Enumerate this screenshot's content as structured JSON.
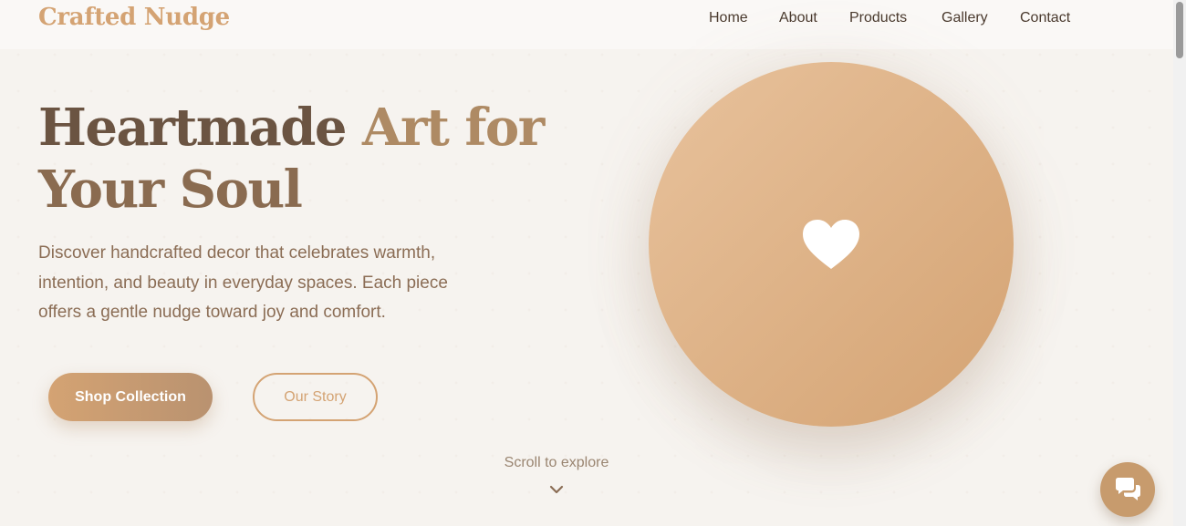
{
  "brand": {
    "name": "Crafted Nudge"
  },
  "nav": {
    "items": [
      "Home",
      "About",
      "Products",
      "Gallery",
      "Contact"
    ]
  },
  "hero": {
    "title_part1": "Heartmade ",
    "title_part2": "Art for",
    "title_part3": "Your Soul",
    "description": "Discover handcrafted decor that celebrates warmth, intention, and beauty in everyday spaces. Each piece offers a gentle nudge toward joy and comfort.",
    "primary_button": "Shop Collection",
    "secondary_button": "Our Story",
    "scroll_hint": "Scroll to explore",
    "emblem_icon": "heart-icon"
  },
  "chat": {
    "icon": "chat-bubbles-icon"
  },
  "colors": {
    "accent": "#d4a373",
    "title_dark": "#6b5442",
    "title_mid": "#8a6b50",
    "title_light": "#ae8a64",
    "body_text": "#8b6d55",
    "nav_text": "#4a3a2e",
    "background": "#f6f3ef"
  }
}
